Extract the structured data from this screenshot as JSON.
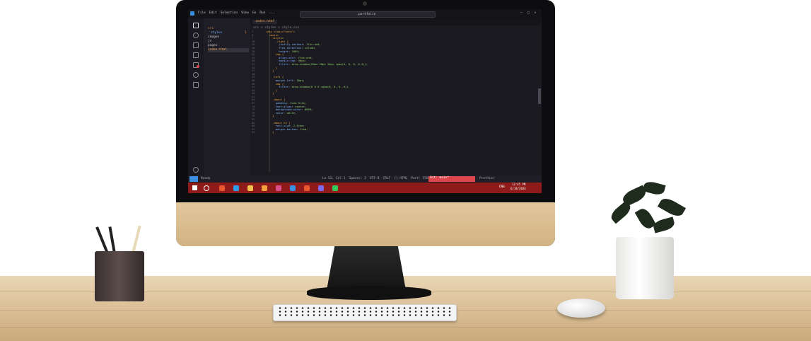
{
  "menu": {
    "items": [
      "File",
      "Edit",
      "Selection",
      "View",
      "Go",
      "Run",
      "..."
    ],
    "search": "portfolio"
  },
  "explorer": {
    "items": [
      "src",
      "styles",
      "images",
      "js",
      "pages",
      "index.html"
    ],
    "badge": "1"
  },
  "tab": {
    "label": "index.html",
    "path": "src > styles > style.css"
  },
  "code": {
    "lines": [
      "<div class=\"hero\">",
      "  <main>",
      "    <style>",
      "      .right {",
      "        justify-content: flex-end;",
      "        flex-direction: column;",
      "        height: 100%;",
      "      img {",
      "        align-self: flex-end;",
      "        margin-top: 30px;",
      "        filter: drop-shadow(20px 20px 10px rgba(0, 0, 0, 0.4));",
      "      }",
      "    }",
      "",
      "    .left {",
      "      margin-left: 10px;",
      "      img {",
      "        filter: drop-shadow(0 0 0 rgba(0, 0, 0, 0));",
      "      }",
      "    }",
      "",
      "    .about {",
      "      padding: 2rem 5rem;",
      "      text-align: center;",
      "      background-color: #000;",
      "      color: white;",
      "    }",
      "",
      "    .about h2 {",
      "      font-size: 2.5rem;",
      "      margin-bottom: 1rem;",
      "    }"
    ]
  },
  "status": {
    "left": "Ready",
    "items": [
      "Ln 52, Col 1",
      "Spaces: 2",
      "UTF-8",
      "CRLF",
      "{} HTML",
      "Port: 5500"
    ],
    "error": "Git: main*",
    "right": "Prettier"
  },
  "taskbar": {
    "time": "12:45 PM",
    "date": "6/18/2024",
    "lang": "ENG"
  },
  "colors": {
    "accent": "#d9474a",
    "taskbar": "#8e1a1a",
    "keyword": "#e6a23c",
    "string": "#8fd16b",
    "property": "#7ab6ff"
  }
}
